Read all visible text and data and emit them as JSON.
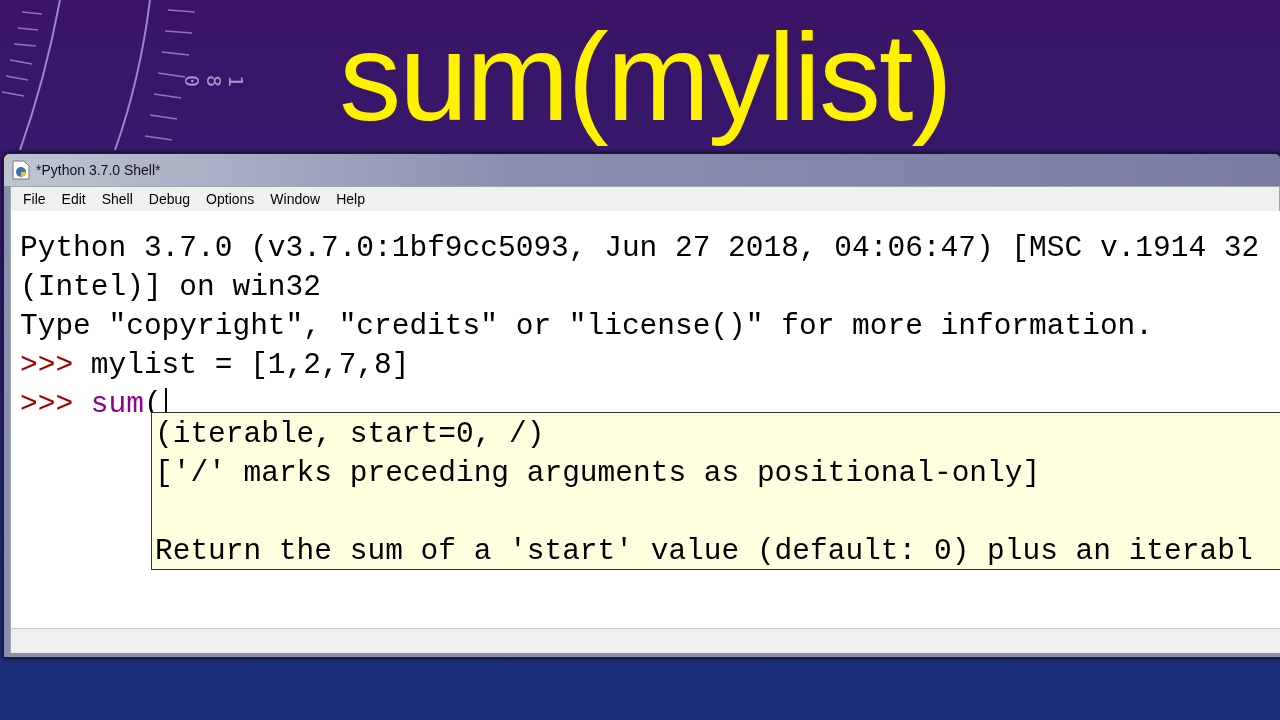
{
  "heading": "sum(mylist)",
  "background": {
    "dial_label": "180"
  },
  "window": {
    "title": "*Python 3.7.0 Shell*",
    "menu": [
      "File",
      "Edit",
      "Shell",
      "Debug",
      "Options",
      "Window",
      "Help"
    ],
    "lines": [
      {
        "kind": "output",
        "text": "Python 3.7.0 (v3.7.0:1bf9cc5093, Jun 27 2018, 04:06:47) [MSC v.1914 32"
      },
      {
        "kind": "output",
        "text": "(Intel)] on win32"
      },
      {
        "kind": "output",
        "text": "Type \"copyright\", \"credits\" or \"license()\" for more information."
      },
      {
        "kind": "input",
        "prompt": ">>>",
        "parts": [
          {
            "kind": "plain",
            "text": "mylist = [1,2,7,8]"
          }
        ]
      },
      {
        "kind": "input",
        "prompt": ">>>",
        "cursor": true,
        "parts": [
          {
            "kind": "builtin",
            "text": "sum"
          },
          {
            "kind": "plain",
            "text": "("
          }
        ]
      }
    ],
    "calltip": [
      "(iterable, start=0, /)",
      "['/' marks preceding arguments as positional-only]",
      "Return the sum of a 'start' value (default: 0) plus an iterabl"
    ]
  }
}
